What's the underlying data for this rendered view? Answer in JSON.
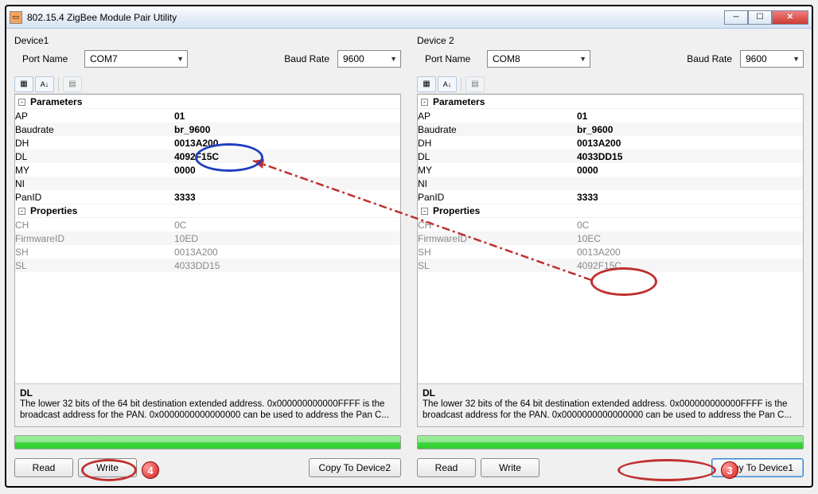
{
  "window": {
    "title": "802.15.4 ZigBee Module Pair Utility"
  },
  "device1": {
    "label": "Device1",
    "port_label": "Port Name",
    "port_value": "COM7",
    "baud_label": "Baud Rate",
    "baud_value": "9600",
    "sections": {
      "parameters_label": "Parameters",
      "properties_label": "Properties"
    },
    "parameters": {
      "AP": "01",
      "Baudrate": "br_9600",
      "DH": "0013A200",
      "DL": "4092F15C",
      "MY": "0000",
      "NI": "",
      "PanID": "3333"
    },
    "properties": {
      "CH": "0C",
      "FirmwareID": "10ED",
      "SH": "0013A200",
      "SL": "4033DD15"
    },
    "desc": {
      "title": "DL",
      "body": "The lower 32 bits of the 64 bit destination extended address. 0x000000000000FFFF is the broadcast address for the PAN. 0x0000000000000000 can be used to address the Pan C..."
    },
    "buttons": {
      "read": "Read",
      "write": "Write",
      "copy": "Copy To Device2"
    }
  },
  "device2": {
    "label": "Device 2",
    "port_label": "Port Name",
    "port_value": "COM8",
    "baud_label": "Baud Rate",
    "baud_value": "9600",
    "sections": {
      "parameters_label": "Parameters",
      "properties_label": "Properties"
    },
    "parameters": {
      "AP": "01",
      "Baudrate": "br_9600",
      "DH": "0013A200",
      "DL": "4033DD15",
      "MY": "0000",
      "NI": "",
      "PanID": "3333"
    },
    "properties": {
      "CH": "0C",
      "FirmwareID": "10EC",
      "SH": "0013A200",
      "SL": "4092F15C"
    },
    "desc": {
      "title": "DL",
      "body": "The lower 32 bits of the 64 bit destination extended address. 0x000000000000FFFF is the broadcast address for the PAN. 0x0000000000000000 can be used to address the Pan C..."
    },
    "buttons": {
      "read": "Read",
      "write": "Write",
      "copy": "Copy To Device1"
    }
  },
  "annotations": {
    "badge3": "3",
    "badge4": "4"
  }
}
